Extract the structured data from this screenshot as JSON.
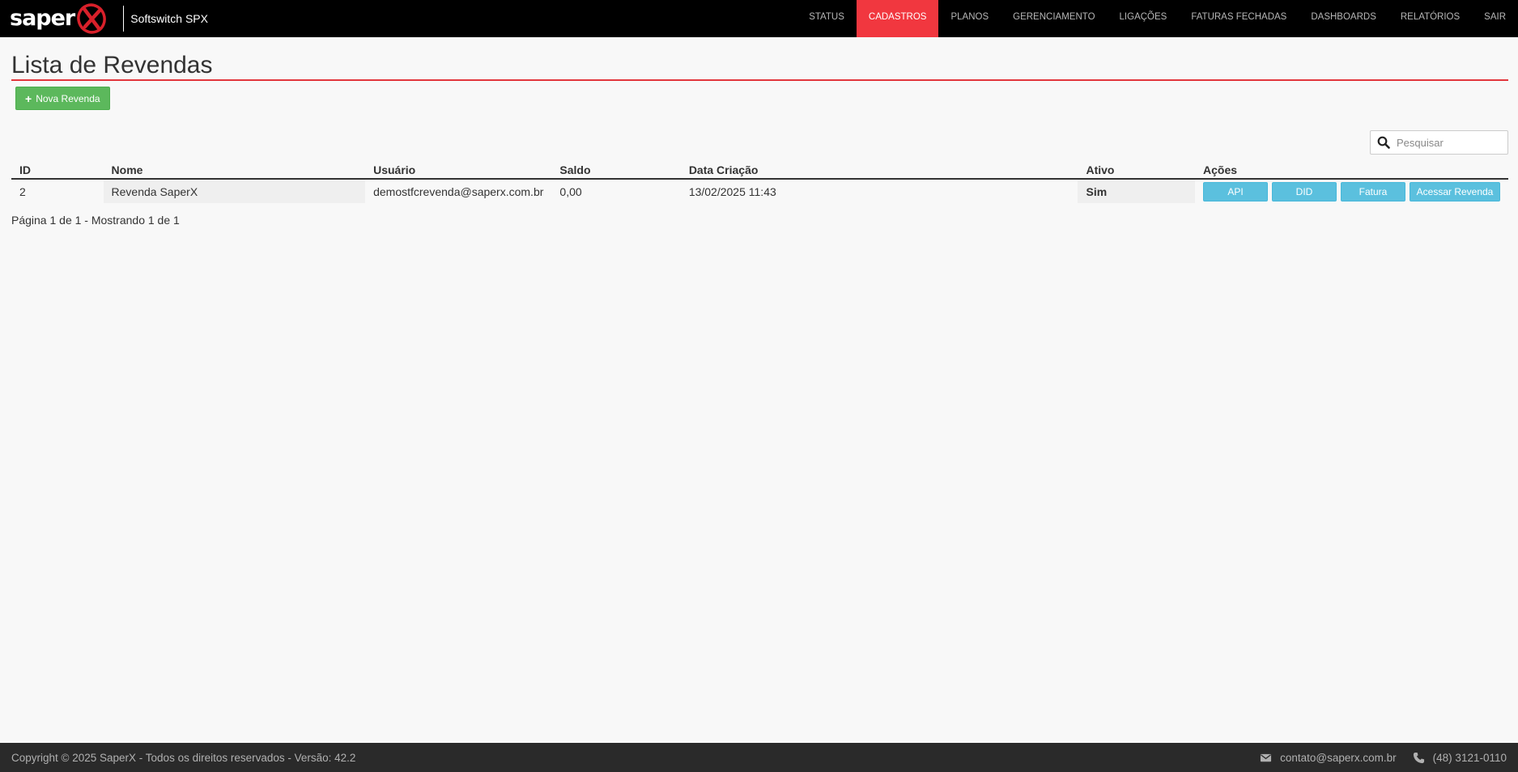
{
  "header": {
    "logo_text": "saper",
    "product": "Softswitch SPX",
    "nav": [
      {
        "label": "STATUS",
        "active": false
      },
      {
        "label": "CADASTROS",
        "active": true
      },
      {
        "label": "PLANOS",
        "active": false
      },
      {
        "label": "GERENCIAMENTO",
        "active": false
      },
      {
        "label": "LIGAÇÕES",
        "active": false
      },
      {
        "label": "FATURAS FECHADAS",
        "active": false
      },
      {
        "label": "DASHBOARDS",
        "active": false
      },
      {
        "label": "RELATÓRIOS",
        "active": false
      },
      {
        "label": "SAIR",
        "active": false
      }
    ],
    "active_color": "#f1373f"
  },
  "main": {
    "title": "Lista de Revendas",
    "new_button": "Nova Revenda",
    "search_placeholder": "Pesquisar",
    "columns": [
      "ID",
      "Nome",
      "Usuário",
      "Saldo",
      "Data Criação",
      "Ativo",
      "Ações"
    ],
    "rows": [
      {
        "id": "2",
        "nome": "Revenda SaperX",
        "usuario": "demostfcrevenda@saperx.com.br",
        "saldo": "0,00",
        "data": "13/02/2025 11:43",
        "ativo": "Sim",
        "actions": [
          "API",
          "DID",
          "Fatura",
          "Acessar Revenda"
        ]
      }
    ],
    "pagination": "Página 1 de 1 - Mostrando 1 de 1"
  },
  "footer": {
    "copyright": "Copyright © 2025 SaperX - Todos os direitos reservados - Versão: 42.2",
    "email": "contato@saperx.com.br",
    "phone": "(48) 3121-0110"
  }
}
